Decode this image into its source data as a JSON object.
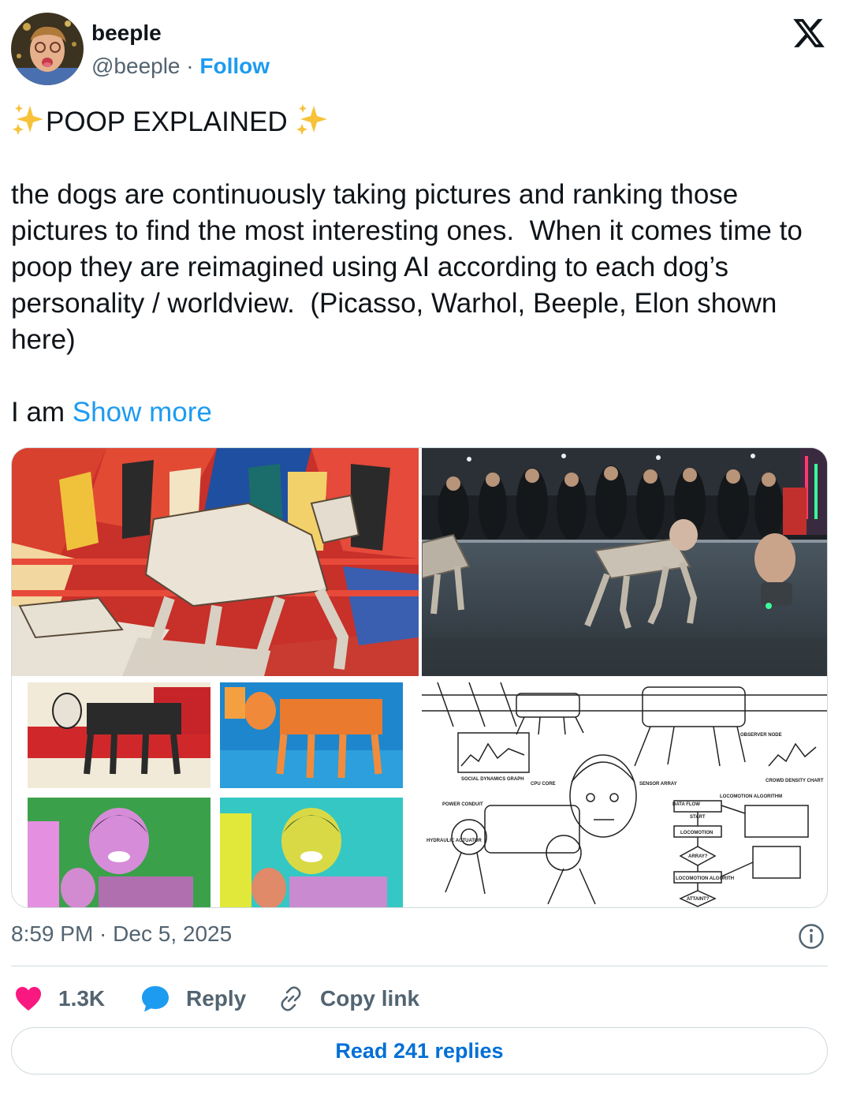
{
  "author": {
    "name": "beeple",
    "handle": "@beeple",
    "separator": " · ",
    "follow_label": "Follow"
  },
  "platform_icon": "x-logo-icon",
  "tweet": {
    "headline": "POOP EXPLAINED",
    "paragraph": "the dogs are continuously taking pictures and ranking those pictures to find the most interesting ones.  When it comes time to poop they are reimagined using AI according to each dog’s personality / worldview.  (Picasso, Warhol, Beeple, Elon shown here)",
    "trailing": "I am ",
    "show_more_label": "Show more",
    "sparkle_icon": "sparkles-icon"
  },
  "media": {
    "diagram_labels": {
      "social": "SOCIAL DYNAMICS GRAPH",
      "cpu": "CPU CORE",
      "sensor": "SENSOR ARRAY",
      "crowd": "CROWD DENSITY CHART",
      "observer": "OBSERVER NODE",
      "loco": "LOCOMOTION ALGORITHM",
      "power": "POWER CONDUIT",
      "hydraulic": "HYDRAULIC ACTUATOR",
      "data_flow": "DATA FLOW",
      "start": "START",
      "locomotion": "LOCOMOTION",
      "array": "ARRAY?",
      "loco_algo": "LOCOMOTION ALGORITH",
      "attain": "ATTAINT?"
    }
  },
  "timestamp": {
    "time": "8:59 PM",
    "separator": " · ",
    "date": "Dec 5, 2025"
  },
  "actions": {
    "like_count": "1.3K",
    "reply_label": "Reply",
    "copy_label": "Copy link"
  },
  "read_replies_label": "Read 241 replies",
  "colors": {
    "accent": "#1d9bf0",
    "like": "#f91880",
    "text": "#0f1419",
    "muted": "#536471"
  }
}
